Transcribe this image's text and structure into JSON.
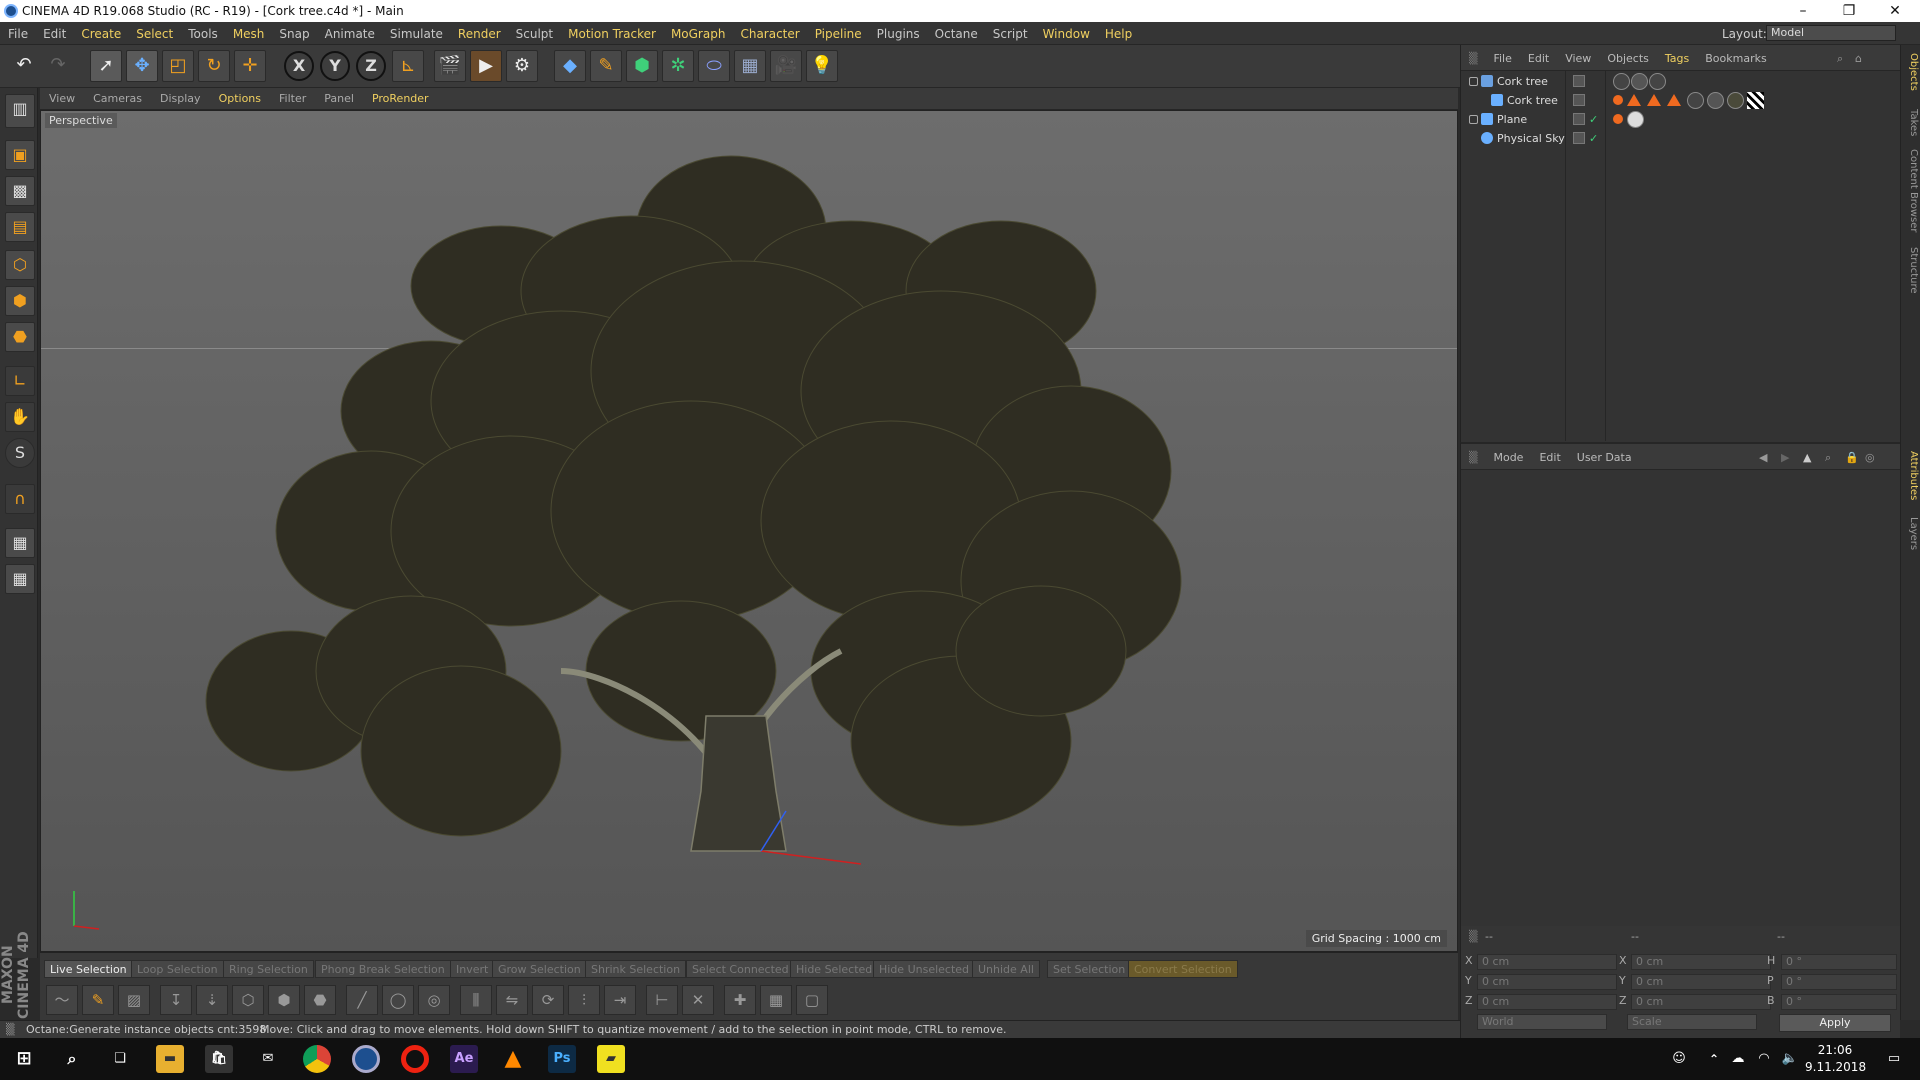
{
  "window": {
    "title": "CINEMA 4D R19.068 Studio (RC - R19) - [Cork tree.c4d *] - Main"
  },
  "menu": [
    "File",
    "Edit",
    "Create",
    "Select",
    "Tools",
    "Mesh",
    "Snap",
    "Animate",
    "Simulate",
    "Render",
    "Sculpt",
    "Motion Tracker",
    "MoGraph",
    "Character",
    "Pipeline",
    "Plugins",
    "Octane",
    "Script",
    "Window",
    "Help"
  ],
  "layout": {
    "label": "Layout:",
    "value": "Model"
  },
  "viewport": {
    "menu": [
      "View",
      "Cameras",
      "Display",
      "Options",
      "Filter",
      "Panel",
      "ProRender"
    ],
    "label": "Perspective",
    "grid_spacing": "Grid Spacing : 1000 cm"
  },
  "selection_buttons": [
    "Live Selection",
    "Loop Selection",
    "Ring Selection",
    "Phong Break Selection",
    "Invert",
    "Grow Selection",
    "Shrink Selection",
    "Select Connected",
    "Hide Selected",
    "Hide Unselected",
    "Unhide All",
    "Set Selection",
    "Convert Selection"
  ],
  "status": {
    "left": "Octane:Generate instance objects cnt:3598",
    "message": "Move: Click and drag to move elements. Hold down SHIFT to quantize movement / add to the selection in point mode, CTRL to remove."
  },
  "object_manager": {
    "menu": [
      "File",
      "Edit",
      "View",
      "Objects",
      "Tags",
      "Bookmarks"
    ],
    "objects": [
      {
        "name": "Cork tree"
      },
      {
        "name": "Cork tree"
      },
      {
        "name": "Plane"
      },
      {
        "name": "Physical Sky"
      }
    ]
  },
  "attributes": {
    "menu": [
      "Mode",
      "Edit",
      "User Data"
    ]
  },
  "coords": {
    "header": [
      "--",
      "--",
      "--"
    ],
    "rows": [
      {
        "a": "X",
        "av": "0 cm",
        "b": "X",
        "bv": "0 cm",
        "c": "H",
        "cv": "0 °"
      },
      {
        "a": "Y",
        "av": "0 cm",
        "b": "Y",
        "bv": "0 cm",
        "c": "P",
        "cv": "0 °"
      },
      {
        "a": "Z",
        "av": "0 cm",
        "b": "Z",
        "bv": "0 cm",
        "c": "B",
        "cv": "0 °"
      }
    ],
    "world": "World",
    "scale": "Scale",
    "apply": "Apply"
  },
  "side_tabs": [
    "Objects",
    "Takes",
    "Content Browser",
    "Structure",
    "Attributes",
    "Layers"
  ],
  "taskbar": {
    "time": "21:06",
    "date": "9.11.2018"
  },
  "brand": "MAXON CINEMA 4D"
}
